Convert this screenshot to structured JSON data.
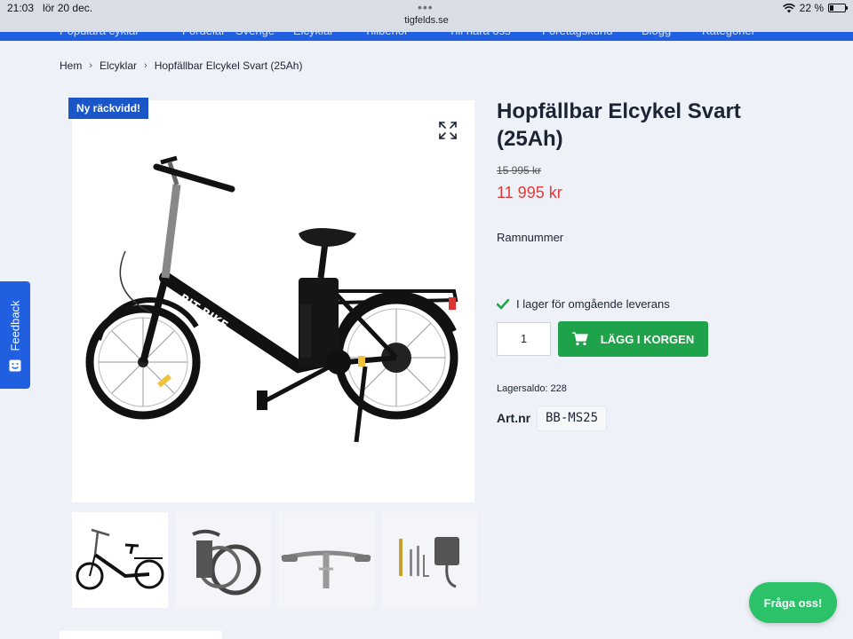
{
  "status_bar": {
    "time": "21:03",
    "date": "lör 20 dec.",
    "url": "tigfelds.se",
    "battery_text": "22 %",
    "battery_level": 0.22
  },
  "nav": {
    "items": [
      "Populära cyklar",
      "Fördelar · Sverige",
      "Elcyklar",
      "Tillbehör",
      "Till nära oss",
      "Företagskund",
      "Blogg",
      "Kategorier"
    ]
  },
  "breadcrumb": {
    "items": [
      "Hem",
      "Elcyklar",
      "Hopfällbar Elcykel Svart (25Ah)"
    ],
    "separator": "›"
  },
  "product": {
    "badge": "Ny räckvidd!",
    "title": "Hopfällbar Elcykel Svart (25Ah)",
    "old_price": "15 995 kr",
    "price": "11 995 kr",
    "frame_label": "Ramnummer",
    "stock_status": "I lager för omgående leverans",
    "quantity": "1",
    "add_to_cart": "LÄGG I KORGEN",
    "stock_balance": "Lagersaldo: 228",
    "art_label": "Art.nr",
    "art_value": "BB-MS25",
    "frame_text": "BIT BIKE"
  },
  "thumbnails": [
    {
      "name": "bike-side"
    },
    {
      "name": "bike-folded"
    },
    {
      "name": "handlebar"
    },
    {
      "name": "tools-charger"
    }
  ],
  "feedback": {
    "label": "Feedback"
  },
  "chat": {
    "label": "Fråga oss!"
  },
  "colors": {
    "brand_blue": "#1f5fe0",
    "badge_blue": "#1a56c8",
    "price_red": "#e03b3b",
    "cart_green": "#1fa34a",
    "chat_green": "#2cc26a"
  },
  "icons": [
    "wifi-icon",
    "battery-icon",
    "expand-icon",
    "check-icon",
    "cart-icon",
    "smile-icon"
  ]
}
